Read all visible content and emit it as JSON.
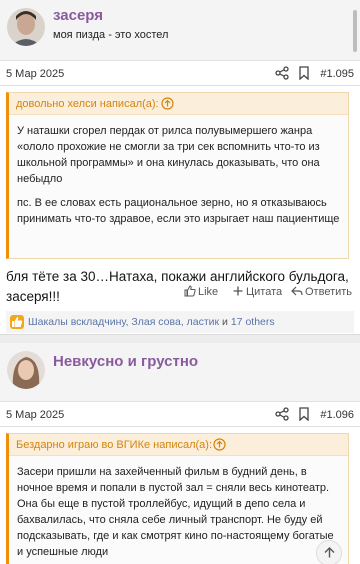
{
  "post1": {
    "author": "засеря",
    "user_title": "моя пизда - это хостел",
    "date": "5 Мар 2025",
    "number": "#1.095",
    "quote": {
      "title": "довольно хелси написал(а):",
      "paragraphs": [
        "У наташки сгорел пердак от рилса полувымершего жанра «ололо прохожие не смогли за три сек вспомнить что-то из школьной программы» и она кинулась доказывать, что она небыдло",
        "пс. В ее словах есть рациональное зерно, но я отказываюсь принимать что-то здравое, если это изрыгает наш пациентище"
      ]
    },
    "message": "бля тёте за 30…Натаха, покажи английского бульдога, засеря!!!",
    "actions": {
      "like": "Like",
      "quote": "Цитата",
      "reply": "Ответить"
    },
    "reactions": {
      "users": "Шакалы вскладчину, Злая сова, ластик",
      "connector": " и ",
      "others": "17 others"
    }
  },
  "post2": {
    "author": "Невкусно и грустно",
    "date": "5 Мар 2025",
    "number": "#1.096",
    "quote": {
      "title": "Бездарно играю во ВГИКе написал(а):",
      "paragraphs": [
        "Засери пришли на захейченный фильм в будний день, в ночное время и попали в пустой зал = сняли весь кинотеатр. Она бы еще в пустой троллейбус, идущий в депо села и бахвалилась, что сняла себе личный транспорт. Не буду ей подсказывать, где и как смотрят кино по-настоящему богатые и успешные люди"
      ]
    }
  },
  "colors": {
    "author": "#8a5a9e",
    "quote_accent": "#f08f0a",
    "quote_title": "#d4850c",
    "link": "#5a74a8",
    "reaction_badge": "#f2a81d"
  },
  "icons": [
    "share-icon",
    "bookmark-icon",
    "arrow-up-circle-icon",
    "thumbs-up-icon",
    "plus-icon",
    "reply-icon",
    "scroll-to-top-icon"
  ]
}
